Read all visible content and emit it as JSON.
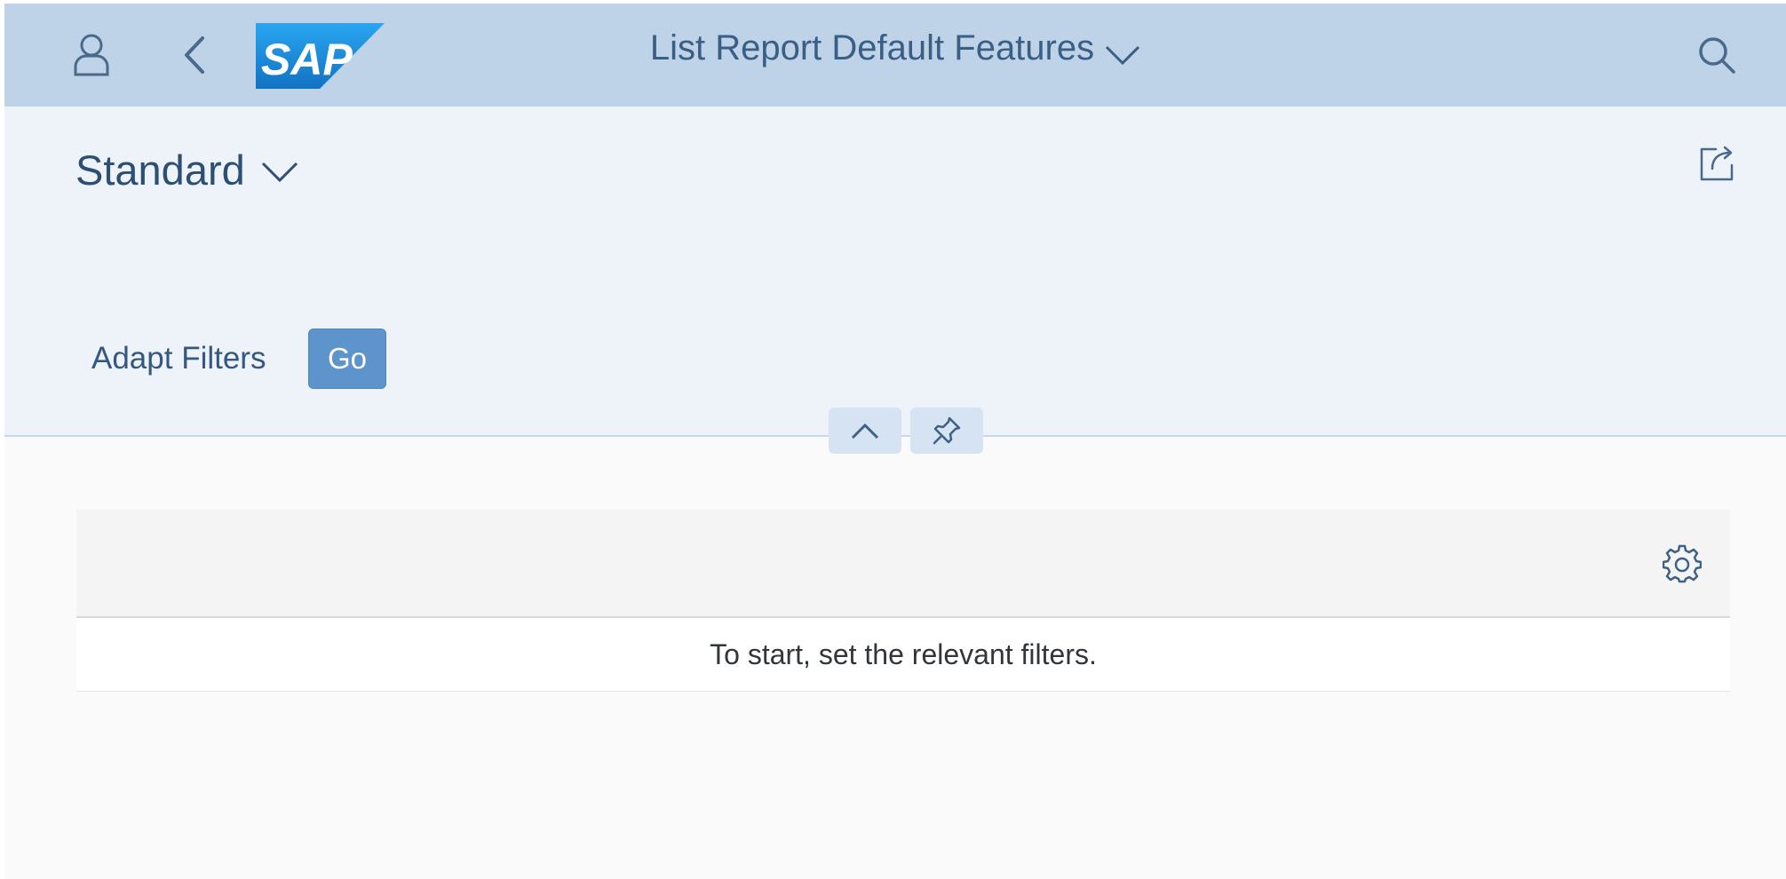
{
  "shell": {
    "title": "List Report Default Features",
    "logo_text": "SAP",
    "icons": {
      "user": "user-icon",
      "back": "back-icon",
      "search": "search-icon",
      "title_menu": "chevron-down-icon"
    }
  },
  "header": {
    "variant_name": "Standard",
    "share_icon": "share-icon",
    "adapt_filters_label": "Adapt Filters",
    "go_label": "Go",
    "collapse_icon": "chevron-up-icon",
    "pin_icon": "pin-icon"
  },
  "table": {
    "settings_icon": "gear-icon",
    "no_data_text": "To start, set the relevant filters."
  },
  "colors": {
    "shell_background": "#bed2e8",
    "header_background": "#eef3fa",
    "go_button": "#5e94cc",
    "logo_blue": "#1c8fe0"
  }
}
